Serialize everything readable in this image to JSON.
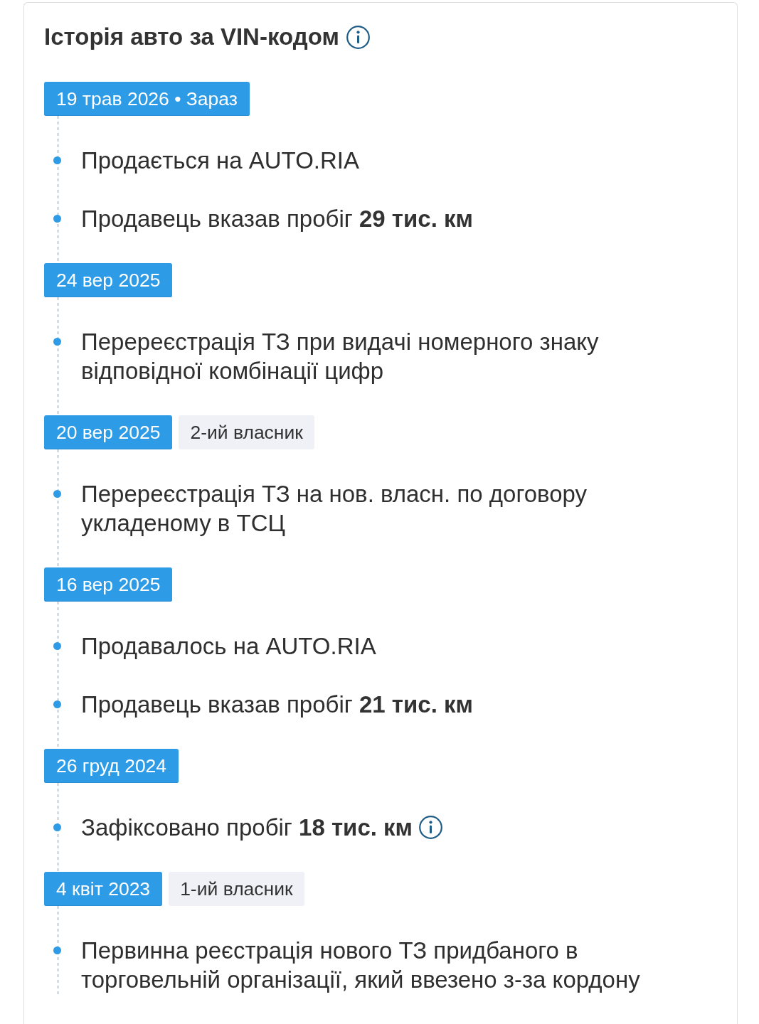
{
  "card": {
    "title": "Історія авто за VIN-кодом",
    "title_info_icon": true
  },
  "events": [
    {
      "date": "19 трав 2026 • Зараз",
      "items": [
        {
          "text": "Продається на AUTO.RIA",
          "info_icon": false
        },
        {
          "text": "Продавець вказав пробіг **29 тис. км**",
          "info_icon": false
        }
      ]
    },
    {
      "date": "24 вер 2025",
      "items": [
        {
          "text": "Перереєстрація ТЗ при видачі номерного знаку відповідної комбінації цифр",
          "info_icon": false
        }
      ]
    },
    {
      "date": "20 вер 2025",
      "owner": "2-ий власник",
      "items": [
        {
          "text": "Перереєстрація ТЗ на нов. власн. по договору укладеному в ТСЦ",
          "info_icon": false
        }
      ]
    },
    {
      "date": "16 вер 2025",
      "items": [
        {
          "text": "Продавалось на AUTO.RIA",
          "info_icon": false
        },
        {
          "text": "Продавець вказав пробіг **21 тис. км**",
          "info_icon": false
        }
      ]
    },
    {
      "date": "26 груд 2024",
      "items": [
        {
          "text": "Зафіксовано пробіг **18 тис. км**",
          "info_icon": true
        }
      ]
    },
    {
      "date": "4 квіт 2023",
      "owner": "1-ий власник",
      "items": [
        {
          "text": "Первинна реєстрація нового ТЗ придбаного в торговельній організації, який ввезено з-за кордону",
          "info_icon": false
        }
      ]
    }
  ]
}
